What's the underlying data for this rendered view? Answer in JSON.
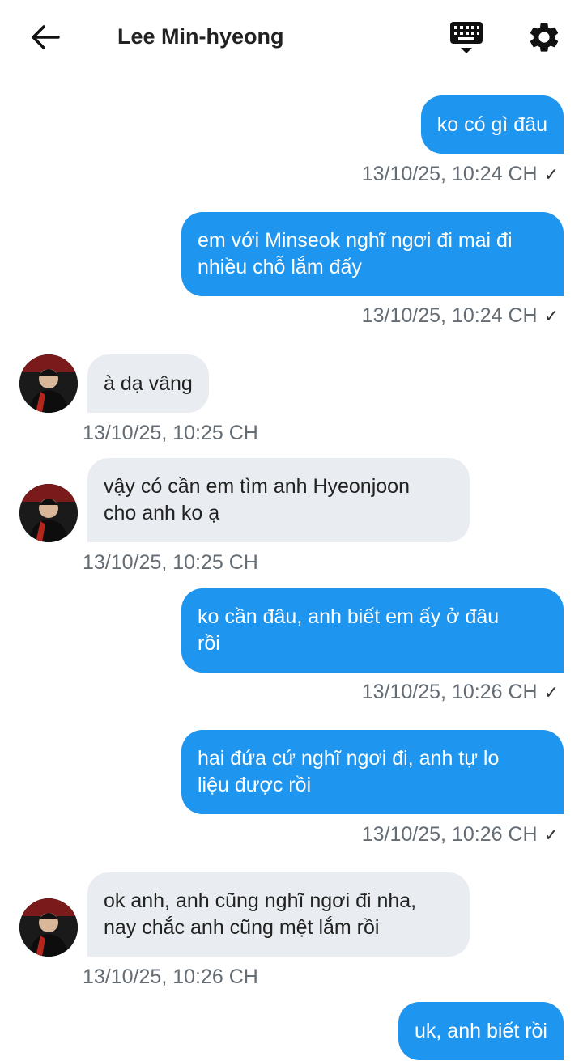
{
  "header": {
    "title": "Lee Min-hyeong",
    "back_icon": "arrow-left-icon",
    "keyboard_icon": "keyboard-icon",
    "settings_icon": "gear-icon"
  },
  "colors": {
    "outgoing": "#1e96f0",
    "incoming": "#e9edf1"
  },
  "messages": [
    {
      "dir": "out",
      "lines": [
        "ko có gì đâu"
      ],
      "time": "13/10/25, 10:24 CH",
      "read": true
    },
    {
      "dir": "out",
      "lines": [
        "em với Minseok nghĩ ngơi đi mai đi",
        "nhiều chỗ lắm đấy"
      ],
      "time": "13/10/25, 10:24 CH",
      "read": true
    },
    {
      "dir": "in",
      "lines": [
        "à dạ vâng"
      ],
      "time": "13/10/25, 10:25 CH"
    },
    {
      "dir": "in",
      "lines": [
        "vậy có cần em tìm anh Hyeonjoon",
        "cho anh ko ạ"
      ],
      "time": "13/10/25, 10:25 CH"
    },
    {
      "dir": "out",
      "lines": [
        "ko cần đâu, anh biết em ấy ở đâu",
        "rồi"
      ],
      "time": "13/10/25, 10:26 CH",
      "read": true
    },
    {
      "dir": "out",
      "lines": [
        "hai đứa cứ nghĩ ngơi đi, anh tự lo",
        "liệu được rồi"
      ],
      "time": "13/10/25, 10:26 CH",
      "read": true
    },
    {
      "dir": "in",
      "lines": [
        "ok anh, anh cũng nghĩ ngơi đi nha,",
        "nay chắc anh cũng mệt lắm rồi"
      ],
      "time": "13/10/25, 10:26 CH"
    },
    {
      "dir": "out",
      "lines": [
        "uk, anh biết rồi"
      ]
    }
  ]
}
